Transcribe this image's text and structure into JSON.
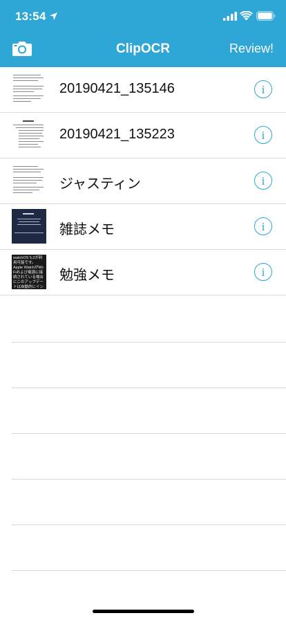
{
  "status_bar": {
    "time": "13:54"
  },
  "nav": {
    "title": "ClipOCR",
    "review_label": "Review!",
    "camera_icon": "camera-icon"
  },
  "items": [
    {
      "title": "20190421_135146",
      "thumb_style": "document"
    },
    {
      "title": "20190421_135223",
      "thumb_style": "document"
    },
    {
      "title": "ジャスティン",
      "thumb_style": "document"
    },
    {
      "title": "雑誌メモ",
      "thumb_style": "dark"
    },
    {
      "title": "勉強メモ",
      "thumb_style": "black",
      "thumb_text": "watchOS 5.2が利用可能です。Apple WatchがWi-Fiおよび電源に接続されている場合にこのアップデートは自動的にインストールされます。"
    }
  ],
  "colors": {
    "accent": "#2ea6d6"
  }
}
